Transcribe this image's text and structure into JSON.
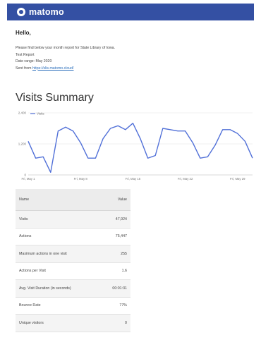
{
  "header": {
    "logo_text": "matomo"
  },
  "intro": {
    "greeting": "Hello,",
    "line1": "Please find below your month report for State Library of Iowa.",
    "line2": "Test Report",
    "line3": "Date range: May 2020",
    "sent_from_label": "Sent from",
    "sent_from_link": "https://slis.matomo.cloud/"
  },
  "section_title": "Visits Summary",
  "chart_data": {
    "type": "line",
    "legend": "Visits",
    "legend_position": "top-left",
    "grid": true,
    "ylim": [
      0,
      2400
    ],
    "y_ticks": [
      {
        "value": 0,
        "label": "0"
      },
      {
        "value": 1200,
        "label": "1,200"
      },
      {
        "value": 2400,
        "label": "2,400"
      }
    ],
    "x_ticks": [
      {
        "index": 0,
        "label": "Fri, May 1"
      },
      {
        "index": 7,
        "label": "Fri, May 8"
      },
      {
        "index": 14,
        "label": "Fri, May 15"
      },
      {
        "index": 21,
        "label": "Fri, May 22"
      },
      {
        "index": 28,
        "label": "Fri, May 29"
      }
    ],
    "series": [
      {
        "name": "Visits",
        "color": "#5170d8",
        "values": [
          1300,
          650,
          700,
          100,
          1700,
          1850,
          1700,
          1250,
          650,
          650,
          1400,
          1800,
          1900,
          1750,
          2000,
          1400,
          650,
          750,
          1800,
          1750,
          1700,
          1700,
          1250,
          650,
          700,
          1150,
          1750,
          1750,
          1600,
          1300,
          650
        ]
      }
    ]
  },
  "table": {
    "headers": [
      "Name",
      "Value"
    ],
    "rows": [
      {
        "name": "Visits",
        "value": "47,924"
      },
      {
        "name": "Actions",
        "value": "75,447"
      },
      {
        "name": "Maximum actions in one visit",
        "value": "255"
      },
      {
        "name": "Actions per Visit",
        "value": "1.6"
      },
      {
        "name": "Avg. Visit Duration (in seconds)",
        "value": "00:01:31"
      },
      {
        "name": "Bounce Rate",
        "value": "77%"
      },
      {
        "name": "Unique visitors",
        "value": "0"
      }
    ]
  }
}
